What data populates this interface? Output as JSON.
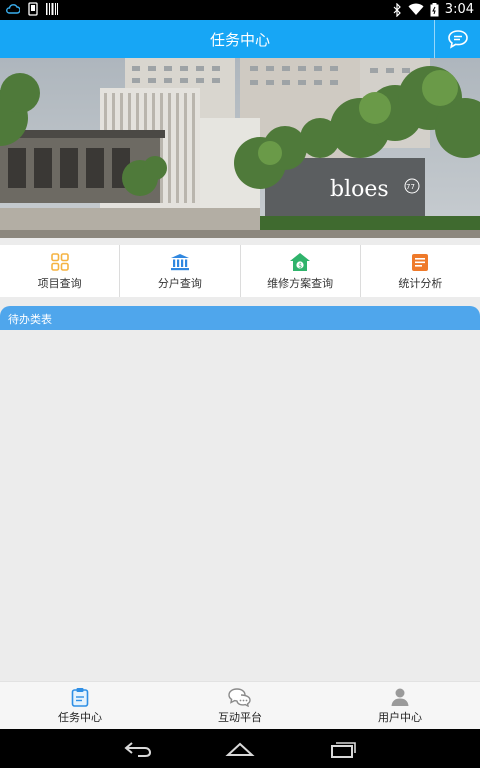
{
  "status_bar": {
    "time": "3:04"
  },
  "app_bar": {
    "title": "任务中心"
  },
  "banner": {
    "sign_text": "bloes",
    "sign_number": "77"
  },
  "quick_nav": [
    {
      "label": "项目查询",
      "icon": "grid-icon",
      "color": "#f5b342"
    },
    {
      "label": "分户查询",
      "icon": "bank-icon",
      "color": "#2f87e0"
    },
    {
      "label": "维修方案查询",
      "icon": "house-money-icon",
      "color": "#2fb36b"
    },
    {
      "label": "统计分析",
      "icon": "document-icon",
      "color": "#ef7a2a"
    }
  ],
  "todo_panel": {
    "title": "待办类表"
  },
  "tab_bar": [
    {
      "label": "任务中心",
      "icon": "clipboard-icon",
      "active": true
    },
    {
      "label": "互动平台",
      "icon": "chat-icon",
      "active": false
    },
    {
      "label": "用户中心",
      "icon": "user-icon",
      "active": false
    }
  ],
  "colors": {
    "primary": "#17a6f5",
    "panel_header": "#4fa6ec",
    "background": "#ececec"
  }
}
